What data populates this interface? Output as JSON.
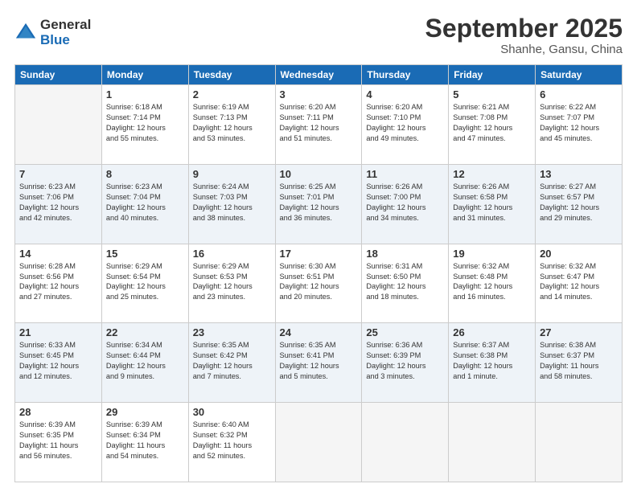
{
  "header": {
    "logo_general": "General",
    "logo_blue": "Blue",
    "month_title": "September 2025",
    "location": "Shanhe, Gansu, China"
  },
  "calendar": {
    "days_of_week": [
      "Sunday",
      "Monday",
      "Tuesday",
      "Wednesday",
      "Thursday",
      "Friday",
      "Saturday"
    ],
    "weeks": [
      [
        {
          "day": "",
          "info": ""
        },
        {
          "day": "1",
          "info": "Sunrise: 6:18 AM\nSunset: 7:14 PM\nDaylight: 12 hours\nand 55 minutes."
        },
        {
          "day": "2",
          "info": "Sunrise: 6:19 AM\nSunset: 7:13 PM\nDaylight: 12 hours\nand 53 minutes."
        },
        {
          "day": "3",
          "info": "Sunrise: 6:20 AM\nSunset: 7:11 PM\nDaylight: 12 hours\nand 51 minutes."
        },
        {
          "day": "4",
          "info": "Sunrise: 6:20 AM\nSunset: 7:10 PM\nDaylight: 12 hours\nand 49 minutes."
        },
        {
          "day": "5",
          "info": "Sunrise: 6:21 AM\nSunset: 7:08 PM\nDaylight: 12 hours\nand 47 minutes."
        },
        {
          "day": "6",
          "info": "Sunrise: 6:22 AM\nSunset: 7:07 PM\nDaylight: 12 hours\nand 45 minutes."
        }
      ],
      [
        {
          "day": "7",
          "info": "Sunrise: 6:23 AM\nSunset: 7:06 PM\nDaylight: 12 hours\nand 42 minutes."
        },
        {
          "day": "8",
          "info": "Sunrise: 6:23 AM\nSunset: 7:04 PM\nDaylight: 12 hours\nand 40 minutes."
        },
        {
          "day": "9",
          "info": "Sunrise: 6:24 AM\nSunset: 7:03 PM\nDaylight: 12 hours\nand 38 minutes."
        },
        {
          "day": "10",
          "info": "Sunrise: 6:25 AM\nSunset: 7:01 PM\nDaylight: 12 hours\nand 36 minutes."
        },
        {
          "day": "11",
          "info": "Sunrise: 6:26 AM\nSunset: 7:00 PM\nDaylight: 12 hours\nand 34 minutes."
        },
        {
          "day": "12",
          "info": "Sunrise: 6:26 AM\nSunset: 6:58 PM\nDaylight: 12 hours\nand 31 minutes."
        },
        {
          "day": "13",
          "info": "Sunrise: 6:27 AM\nSunset: 6:57 PM\nDaylight: 12 hours\nand 29 minutes."
        }
      ],
      [
        {
          "day": "14",
          "info": "Sunrise: 6:28 AM\nSunset: 6:56 PM\nDaylight: 12 hours\nand 27 minutes."
        },
        {
          "day": "15",
          "info": "Sunrise: 6:29 AM\nSunset: 6:54 PM\nDaylight: 12 hours\nand 25 minutes."
        },
        {
          "day": "16",
          "info": "Sunrise: 6:29 AM\nSunset: 6:53 PM\nDaylight: 12 hours\nand 23 minutes."
        },
        {
          "day": "17",
          "info": "Sunrise: 6:30 AM\nSunset: 6:51 PM\nDaylight: 12 hours\nand 20 minutes."
        },
        {
          "day": "18",
          "info": "Sunrise: 6:31 AM\nSunset: 6:50 PM\nDaylight: 12 hours\nand 18 minutes."
        },
        {
          "day": "19",
          "info": "Sunrise: 6:32 AM\nSunset: 6:48 PM\nDaylight: 12 hours\nand 16 minutes."
        },
        {
          "day": "20",
          "info": "Sunrise: 6:32 AM\nSunset: 6:47 PM\nDaylight: 12 hours\nand 14 minutes."
        }
      ],
      [
        {
          "day": "21",
          "info": "Sunrise: 6:33 AM\nSunset: 6:45 PM\nDaylight: 12 hours\nand 12 minutes."
        },
        {
          "day": "22",
          "info": "Sunrise: 6:34 AM\nSunset: 6:44 PM\nDaylight: 12 hours\nand 9 minutes."
        },
        {
          "day": "23",
          "info": "Sunrise: 6:35 AM\nSunset: 6:42 PM\nDaylight: 12 hours\nand 7 minutes."
        },
        {
          "day": "24",
          "info": "Sunrise: 6:35 AM\nSunset: 6:41 PM\nDaylight: 12 hours\nand 5 minutes."
        },
        {
          "day": "25",
          "info": "Sunrise: 6:36 AM\nSunset: 6:39 PM\nDaylight: 12 hours\nand 3 minutes."
        },
        {
          "day": "26",
          "info": "Sunrise: 6:37 AM\nSunset: 6:38 PM\nDaylight: 12 hours\nand 1 minute."
        },
        {
          "day": "27",
          "info": "Sunrise: 6:38 AM\nSunset: 6:37 PM\nDaylight: 11 hours\nand 58 minutes."
        }
      ],
      [
        {
          "day": "28",
          "info": "Sunrise: 6:39 AM\nSunset: 6:35 PM\nDaylight: 11 hours\nand 56 minutes."
        },
        {
          "day": "29",
          "info": "Sunrise: 6:39 AM\nSunset: 6:34 PM\nDaylight: 11 hours\nand 54 minutes."
        },
        {
          "day": "30",
          "info": "Sunrise: 6:40 AM\nSunset: 6:32 PM\nDaylight: 11 hours\nand 52 minutes."
        },
        {
          "day": "",
          "info": ""
        },
        {
          "day": "",
          "info": ""
        },
        {
          "day": "",
          "info": ""
        },
        {
          "day": "",
          "info": ""
        }
      ]
    ]
  }
}
